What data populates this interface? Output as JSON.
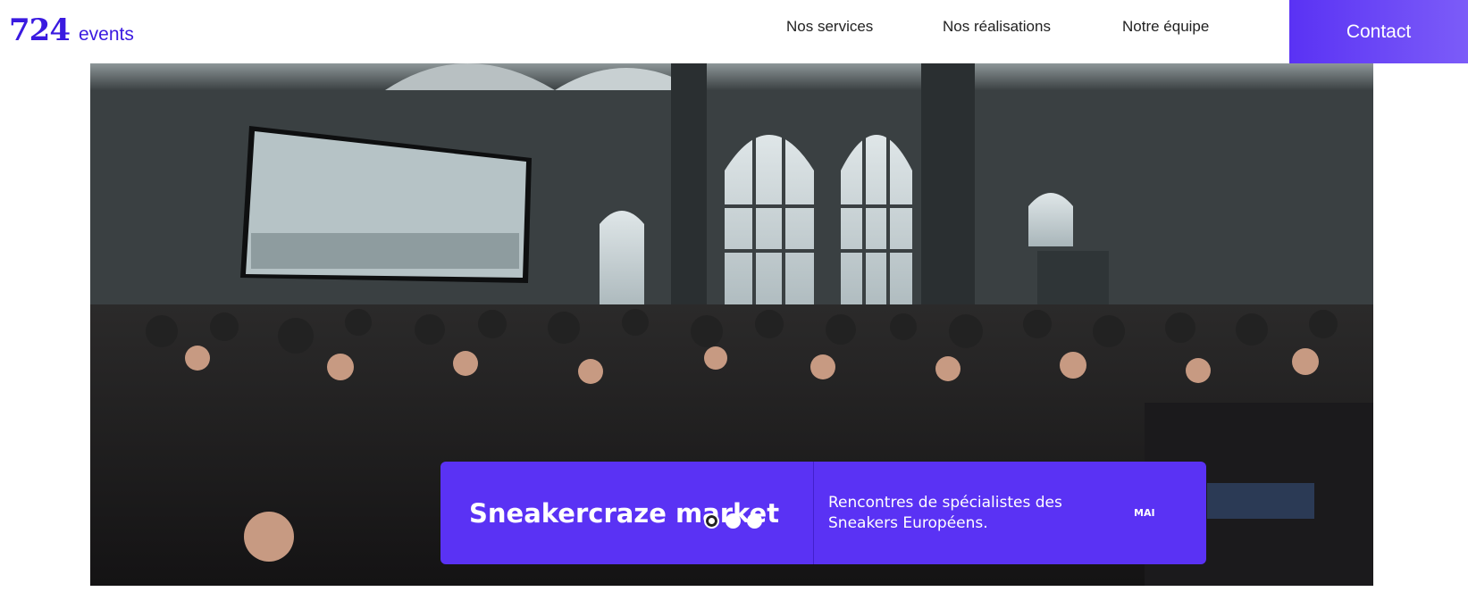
{
  "header": {
    "logo_number": "724",
    "logo_word": "events",
    "nav": [
      {
        "label": "Nos services"
      },
      {
        "label": "Nos réalisations"
      },
      {
        "label": "Notre équipe"
      }
    ],
    "contact_label": "Contact"
  },
  "hero": {
    "slide": {
      "title": "Sneakercraze market",
      "description": "Rencontres de spécialistes des Sneakers Européens.",
      "month": "MAI"
    },
    "dots_total": 3,
    "active_dot": 1
  },
  "colors": {
    "brand": "#5a32f4",
    "logo": "#3a1ae0"
  }
}
